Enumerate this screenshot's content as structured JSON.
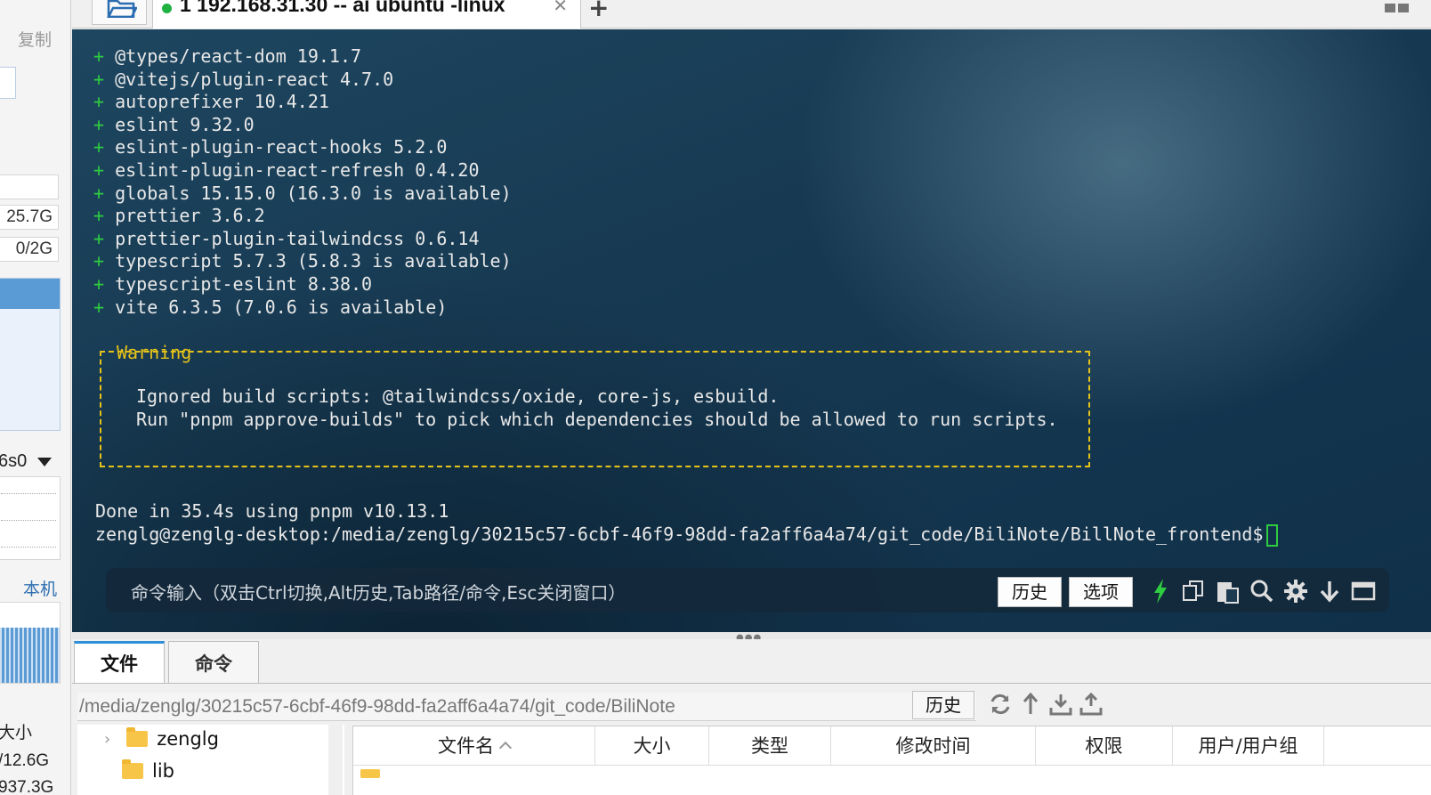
{
  "left_panel": {
    "copy_label": "复制",
    "stat_disk": "25.7G",
    "stat_swap": "0/2G",
    "interface_name": "6s0",
    "local_label": "本机",
    "size_header": "大小",
    "size_value_1": "/12.6G",
    "size_value_2": "937.3G"
  },
  "tabbar": {
    "tab_title": "1 192.168.31.30 -- ai ubuntu  -linux",
    "close_glyph": "✕",
    "add_glyph": "+"
  },
  "terminal": {
    "packages": [
      "@types/react-dom 19.1.7",
      "@vitejs/plugin-react 4.7.0",
      "autoprefixer 10.4.21",
      "eslint 9.32.0",
      "eslint-plugin-react-hooks 5.2.0",
      "eslint-plugin-react-refresh 0.4.20",
      "globals 15.15.0 (16.3.0 is available)",
      "prettier 3.6.2",
      "prettier-plugin-tailwindcss 0.6.14",
      "typescript 5.7.3 (5.8.3 is available)",
      "typescript-eslint 8.38.0",
      "vite 6.3.5 (7.0.6 is available)"
    ],
    "plus_glyph": "+",
    "warning_title": "Warning",
    "warning_line1": "Ignored build scripts: @tailwindcss/oxide, core-js, esbuild.",
    "warning_line2": "Run \"pnpm approve-builds\" to pick which dependencies should be allowed to run scripts.",
    "done_line": "Done in 35.4s using pnpm v10.13.1",
    "prompt": "zenglg@zenglg-desktop:/media/zenglg/30215c57-6cbf-46f9-98dd-fa2aff6a4a74/git_code/BiliNote/BillNote_frontend$",
    "colors": {
      "plus": "#2ecc40",
      "warning": "#e5c21a",
      "text": "#e8e8e8"
    }
  },
  "command_bar": {
    "hint": "命令输入（双击Ctrl切换,Alt历史,Tab路径/命令,Esc关闭窗口）",
    "history_label": "历史",
    "options_label": "选项",
    "icons": [
      "lightning-icon",
      "copy-icon",
      "paste-icon",
      "search-icon",
      "gear-icon",
      "download-arrow-icon",
      "maximize-icon"
    ]
  },
  "file_panel": {
    "tabs": [
      "文件",
      "命令"
    ],
    "path": "/media/zenglg/30215c57-6cbf-46f9-98dd-fa2aff6a4a74/git_code/BiliNote",
    "history_label": "历史",
    "tree": [
      {
        "name": "zenglg",
        "expanded": false
      },
      {
        "name": "lib",
        "expanded": false
      }
    ],
    "columns": [
      "文件名",
      "大小",
      "类型",
      "修改时间",
      "权限",
      "用户/用户组"
    ]
  }
}
